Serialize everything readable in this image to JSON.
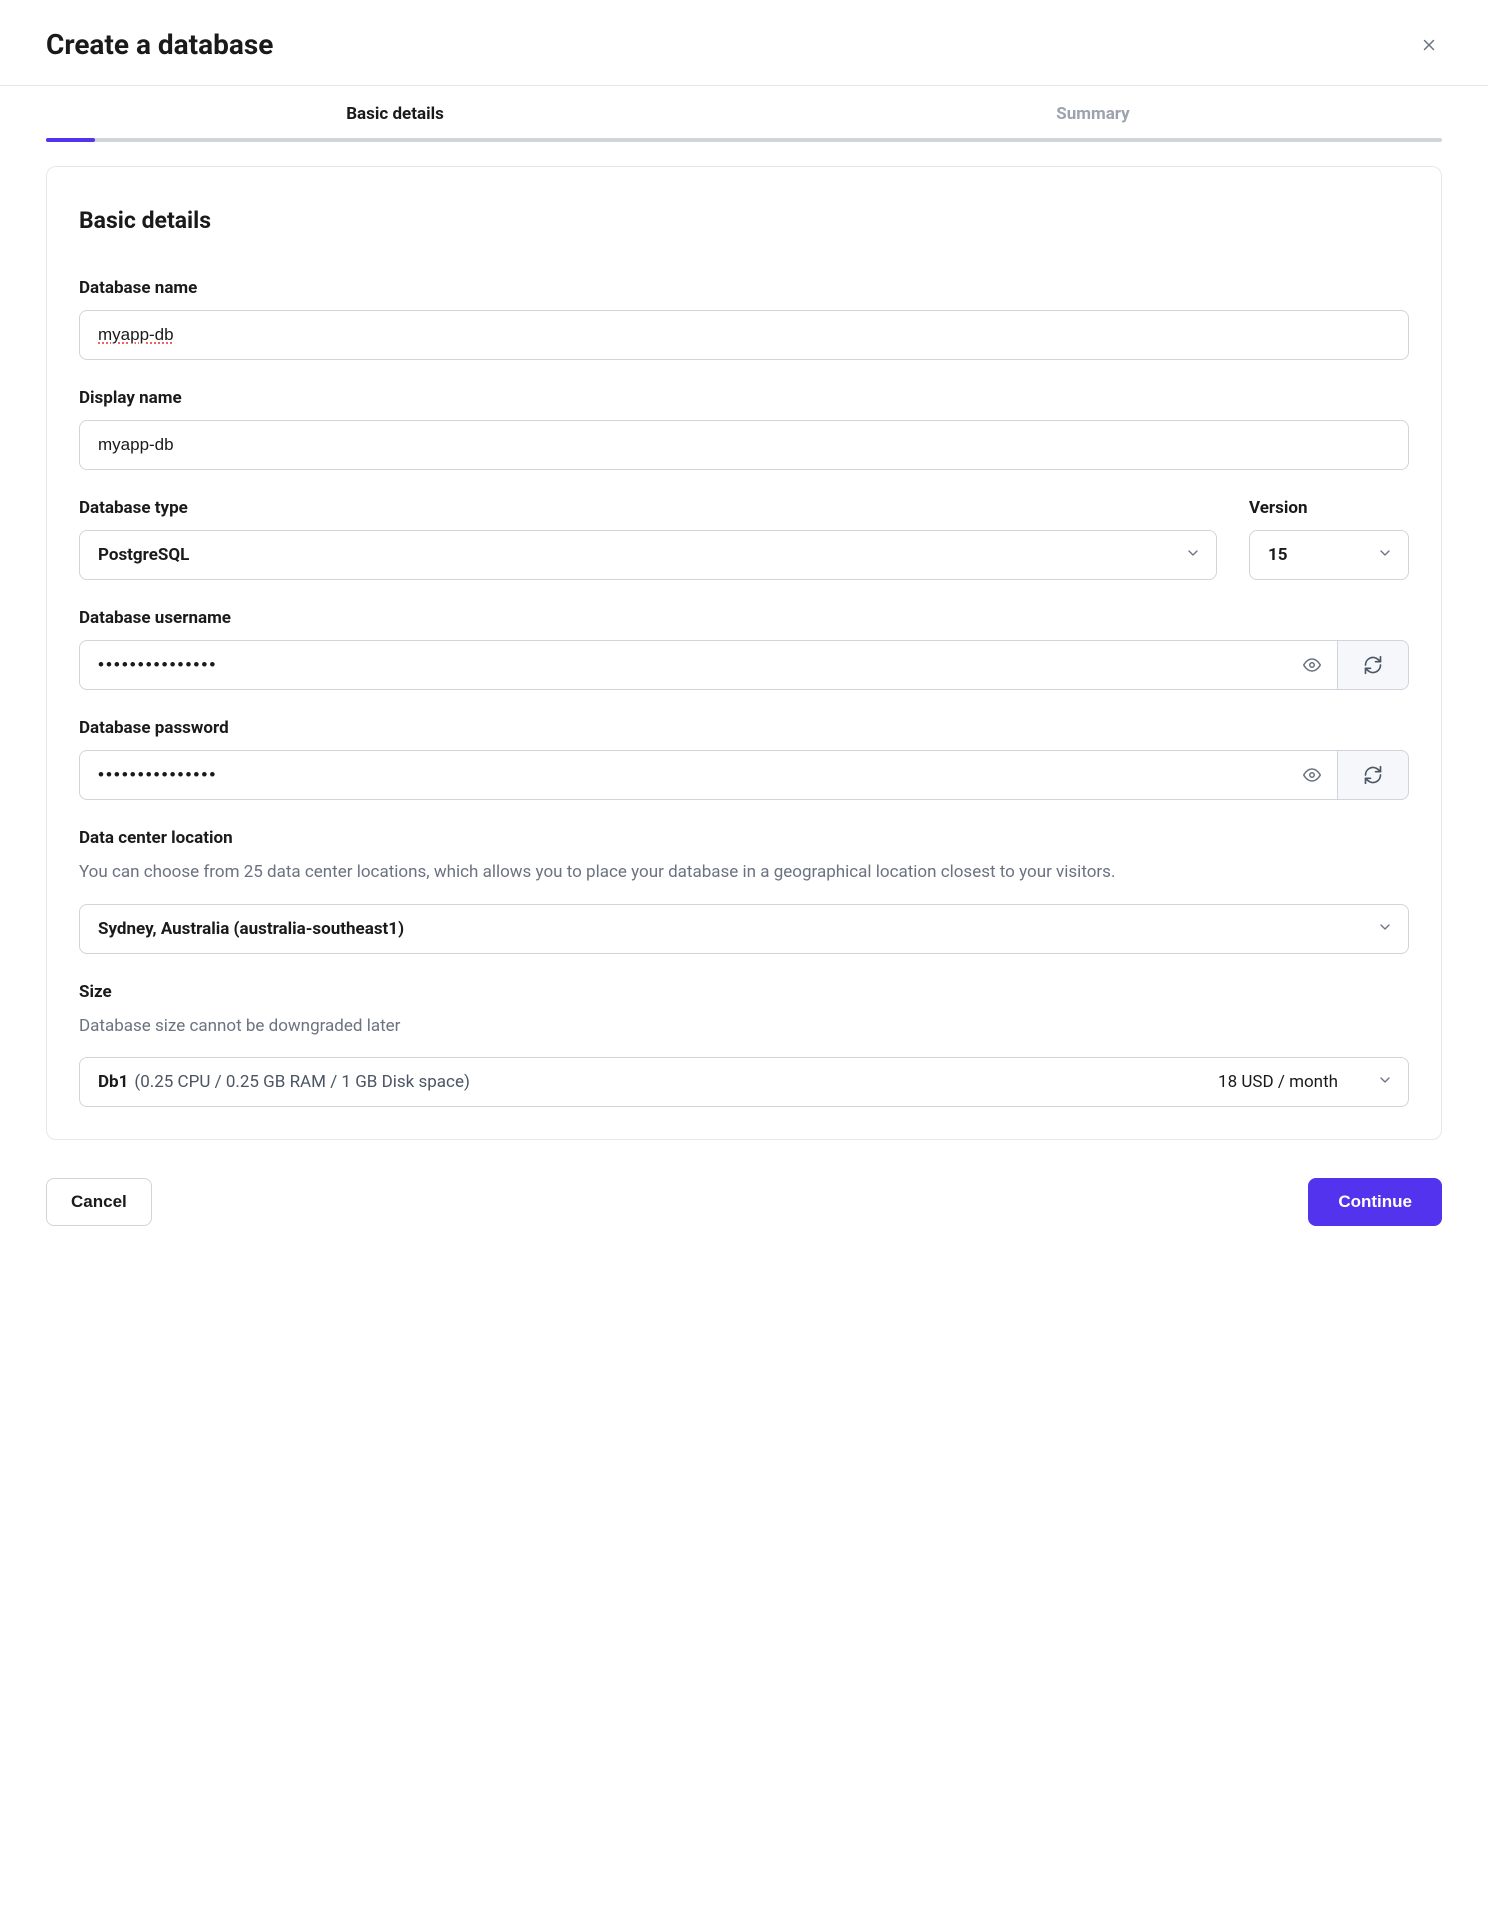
{
  "header": {
    "title": "Create a database"
  },
  "tabs": {
    "basic_details": "Basic details",
    "summary": "Summary"
  },
  "section": {
    "title": "Basic details"
  },
  "form": {
    "database_name": {
      "label": "Database name",
      "value": "myapp-db"
    },
    "display_name": {
      "label": "Display name",
      "value": "myapp-db"
    },
    "database_type": {
      "label": "Database type",
      "value": "PostgreSQL"
    },
    "version": {
      "label": "Version",
      "value": "15"
    },
    "database_username": {
      "label": "Database username",
      "value": "•••••••••••••••"
    },
    "database_password": {
      "label": "Database password",
      "value": "•••••••••••••••"
    },
    "data_center": {
      "label": "Data center location",
      "help": "You can choose from 25 data center locations, which allows you to place your database in a geographical location closest to your visitors.",
      "value": "Sydney, Australia (australia-southeast1)"
    },
    "size": {
      "label": "Size",
      "help": "Database size cannot be downgraded later",
      "name": "Db1",
      "spec": "(0.25 CPU / 0.25 GB RAM / 1 GB Disk space)",
      "price": "18 USD / month"
    }
  },
  "footer": {
    "cancel": "Cancel",
    "continue": "Continue"
  }
}
